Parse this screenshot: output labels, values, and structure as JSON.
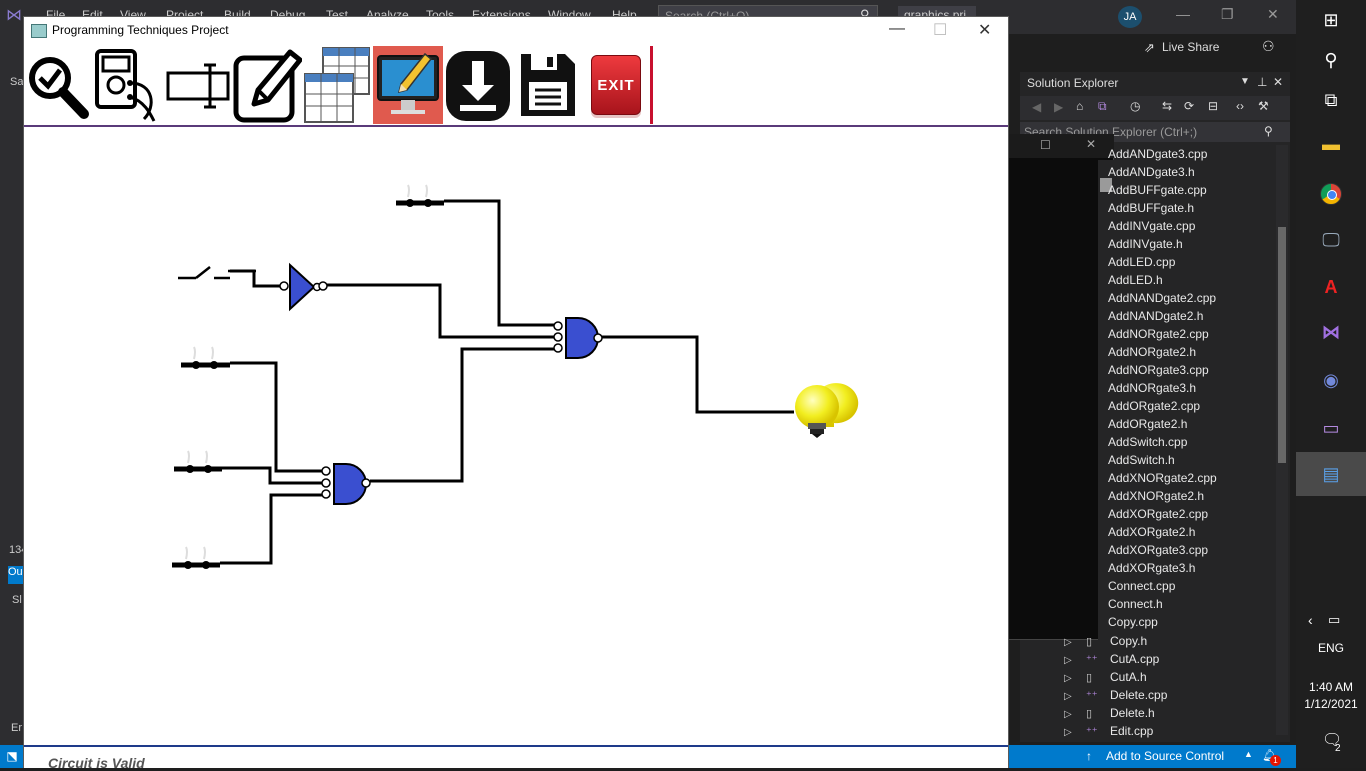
{
  "vs": {
    "menu": [
      "File",
      "Edit",
      "View",
      "Project",
      "Build",
      "Debug",
      "Test",
      "Analyze",
      "Tools",
      "Extensions",
      "Window",
      "Help"
    ],
    "search_placeholder": "Search (Ctrl+Q)",
    "project_badge": "graphics.pri",
    "avatar": "JA",
    "live_share": "Live Share",
    "left_labels": [
      "Sa",
      "134",
      "Ou",
      "Sl",
      "Er"
    ],
    "solution_explorer": {
      "title": "Solution Explorer",
      "search_placeholder": "Search Solution Explorer (Ctrl+;)",
      "files": [
        "AddANDgate3.cpp",
        "AddANDgate3.h",
        "AddBUFFgate.cpp",
        "AddBUFFgate.h",
        "AddINVgate.cpp",
        "AddINVgate.h",
        "AddLED.cpp",
        "AddLED.h",
        "AddNANDgate2.cpp",
        "AddNANDgate2.h",
        "AddNORgate2.cpp",
        "AddNORgate2.h",
        "AddNORgate3.cpp",
        "AddNORgate3.h",
        "AddORgate2.cpp",
        "AddORgate2.h",
        "AddSwitch.cpp",
        "AddSwitch.h",
        "AddXNORgate2.cpp",
        "AddXNORgate2.h",
        "AddXORgate2.cpp",
        "AddXORgate2.h",
        "AddXORgate3.cpp",
        "AddXORgate3.h",
        "Connect.cpp",
        "Connect.h",
        "Copy.cpp"
      ],
      "files_lower": [
        "Copy.h",
        "CutA.cpp",
        "CutA.h",
        "Delete.cpp",
        "Delete.h",
        "Edit.cpp"
      ]
    },
    "status": {
      "add_to_source_control": "Add to Source Control",
      "notifications": "1"
    }
  },
  "app": {
    "title": "Programming Techniques Project",
    "status_text": "Circuit is Valid",
    "toolbar": [
      {
        "name": "validate-tool",
        "icon": "magnifier-check-icon"
      },
      {
        "name": "probe-tool",
        "icon": "multimeter-icon"
      },
      {
        "name": "label-tool",
        "icon": "label-icon"
      },
      {
        "name": "edit-tool",
        "icon": "pencil-square-icon"
      },
      {
        "name": "truth-table-tool",
        "icon": "table-icon"
      },
      {
        "name": "design-mode-tool",
        "icon": "monitor-pencil-icon"
      },
      {
        "name": "load-tool",
        "icon": "download-icon"
      },
      {
        "name": "save-tool",
        "icon": "floppy-icon"
      },
      {
        "name": "exit-tool",
        "icon": "exit-icon",
        "label": "EXIT"
      }
    ]
  },
  "taskbar": {
    "language": "ENG",
    "time": "1:40 AM",
    "date": "1/12/2021",
    "notification_count": "2"
  },
  "colors": {
    "gate_fill": "#3a4fd0",
    "vs_blue": "#007acc",
    "exit_red": "#d8262e",
    "active_tool_bg": "#e05a4e"
  }
}
